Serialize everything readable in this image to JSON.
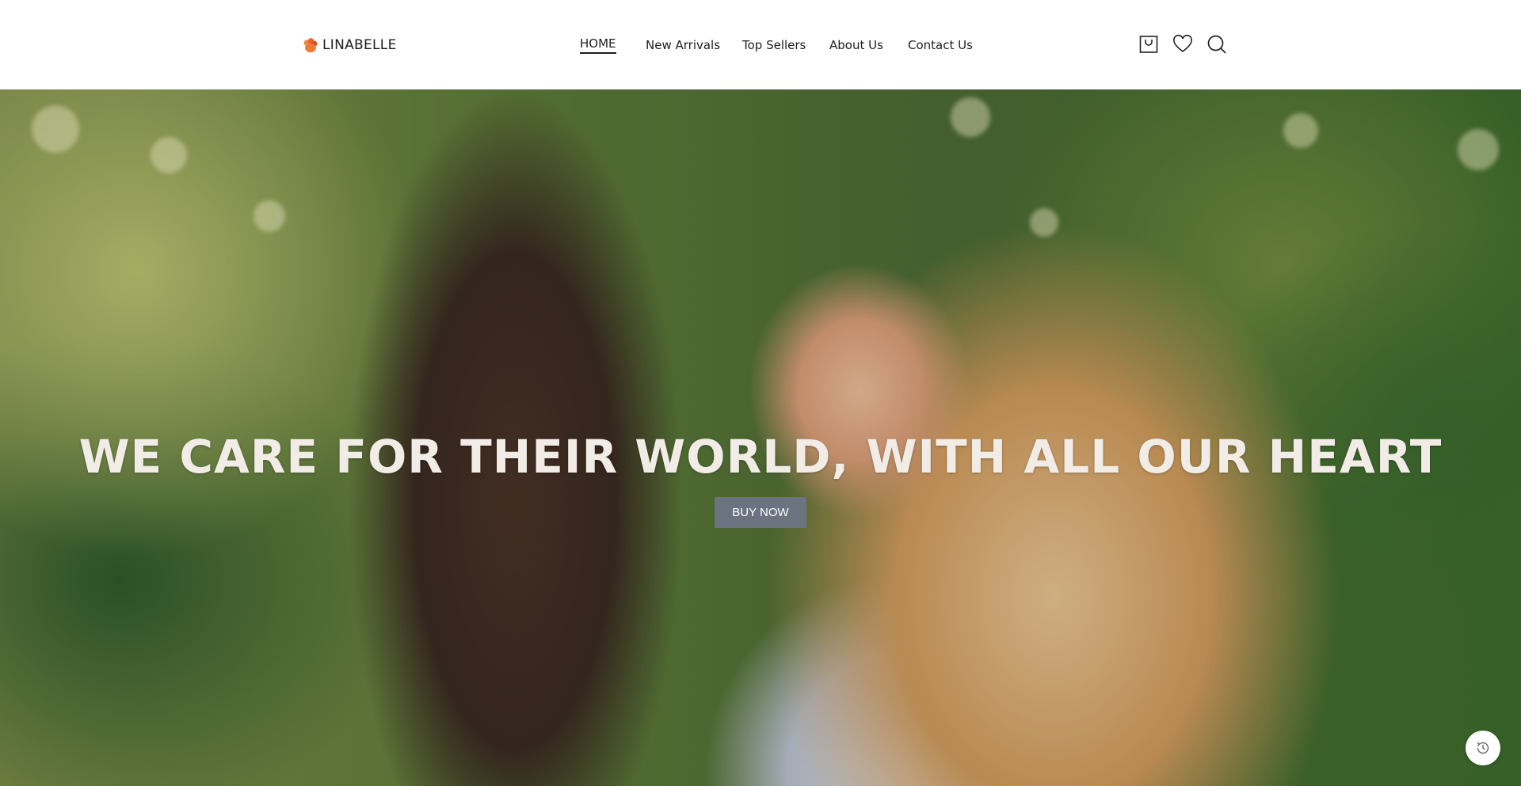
{
  "brand": {
    "name": "LINABELLE"
  },
  "nav": {
    "items": [
      {
        "label": "HOME",
        "active": true
      },
      {
        "label": "New Arrivals"
      },
      {
        "label": "Top Sellers"
      },
      {
        "label": "About Us"
      },
      {
        "label": "Contact Us"
      }
    ]
  },
  "header_icons": [
    "cart-icon",
    "heart-icon",
    "search-icon"
  ],
  "hero": {
    "title": "WE CARE FOR THEIR WORLD, WITH ALL OUR HEART",
    "cta_label": "BUY NOW"
  },
  "floating": {
    "icon": "history-icon"
  },
  "colors": {
    "logo_accent": "#e8632b",
    "cta_background": "#6b7280",
    "hero_title": "#f2ece6"
  }
}
